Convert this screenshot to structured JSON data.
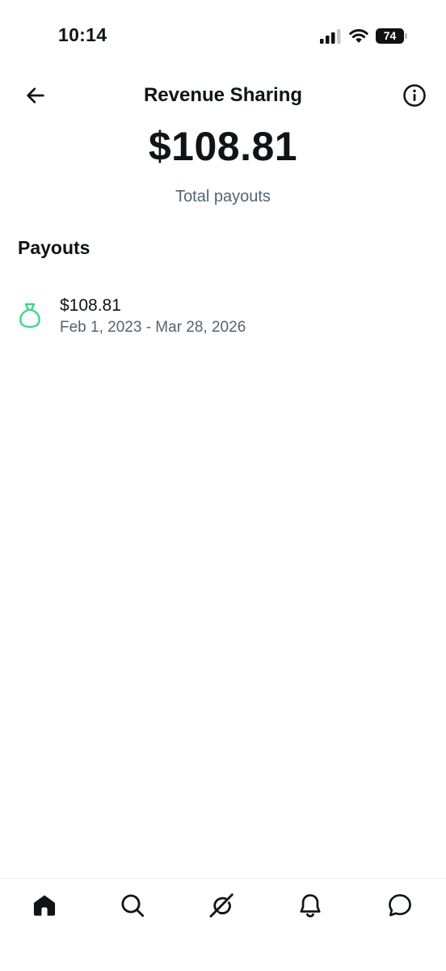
{
  "status_bar": {
    "time": "10:14",
    "battery": "74",
    "signal_icon": "cellular-signal-icon",
    "wifi_icon": "wifi-icon"
  },
  "header": {
    "title": "Revenue Sharing",
    "back_icon": "arrow-left-icon",
    "info_icon": "info-icon"
  },
  "summary": {
    "total": "$108.81",
    "label": "Total payouts"
  },
  "payouts": {
    "section_title": "Payouts",
    "items": [
      {
        "icon": "money-bag-icon",
        "amount": "$108.81",
        "range": "Feb 1, 2023 - Mar 28, 2026"
      }
    ]
  },
  "bottom_nav": {
    "items": [
      "home-icon",
      "search-icon",
      "grok-icon",
      "notifications-icon",
      "messages-icon"
    ]
  },
  "colors": {
    "text": "#0f1419",
    "secondary": "#536471",
    "accent_green": "#3dd68c"
  }
}
